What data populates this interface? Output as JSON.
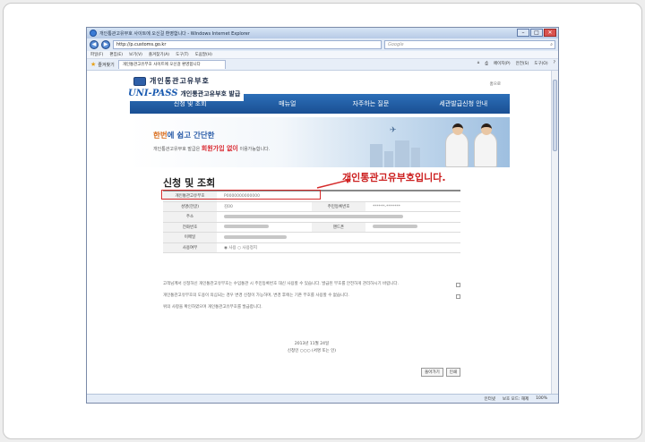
{
  "window": {
    "title": "개인통관고유부호 사이트에 오신걸 환영합니다 - Windows Internet Explorer",
    "url": "http://p.customs.go.kr",
    "search_placeholder": "Google"
  },
  "menubar": [
    "파일(F)",
    "편집(E)",
    "보기(V)",
    "즐겨찾기(A)",
    "도구(T)",
    "도움말(H)"
  ],
  "tabbar": {
    "favorites_label": "즐겨찾기",
    "tab_title": "개인통관고유부호 사이트에 오신걸 환영합니다",
    "tools": [
      "페이지(P)",
      "안전(S)",
      "도구(O)"
    ]
  },
  "site": {
    "agency": "개인통관고유부호",
    "unipass": "UNI-PASS",
    "subtitle": "개인통관고유부호 발급",
    "login": "홈으로",
    "nav": [
      "신청 및 조회",
      "매뉴얼",
      "자주하는 질문",
      "세관발급신청 안내"
    ]
  },
  "banner": {
    "line1_a": "한번",
    "line1_b": "에 쉽고 간단한",
    "line2_a": "개인통관고유부호 발급은",
    "line2_b": "회원가입 없이",
    "line2_c": "이용가능합니다."
  },
  "panel": {
    "title": "신청 및 조회",
    "callout": "개인통관고유부호입니다.",
    "rows": [
      {
        "label": "개인통관고유부호",
        "value": "P0000000000000"
      },
      {
        "label": "성명(한글)",
        "value": "김00",
        "label2": "주민등록번호",
        "value2": "******-*******"
      },
      {
        "label": "주소",
        "value": ""
      },
      {
        "label": "전화번호",
        "value": "",
        "label2": "핸드폰",
        "value2": ""
      },
      {
        "label": "이메일",
        "value": ""
      },
      {
        "label": "사용여부",
        "value": "◉ 사용   ○ 사용정지"
      }
    ],
    "notes": [
      "고객님께서 신청하신 개인통관고유부호는 수입통관 시 주민등록번호 대신 사용할 수 있습니다. 발급된 부호를 안전하게 관리하시기 바랍니다.",
      "개인통관고유부호의 도용이 의심되는 경우 변경 신청이 가능하며, 변경 후에는 기존 부호를 사용할 수 없습니다.",
      "위의 사항을 확인하였으며 개인통관고유부호를 발급합니다."
    ],
    "date": "2013년 11월 24일",
    "applicant": "신청인  ○○○ (서명 또는 인)",
    "buttons": [
      "돌아가기",
      "인쇄"
    ]
  },
  "status": [
    "인터넷",
    "보호 모드: 해제",
    "100%"
  ]
}
